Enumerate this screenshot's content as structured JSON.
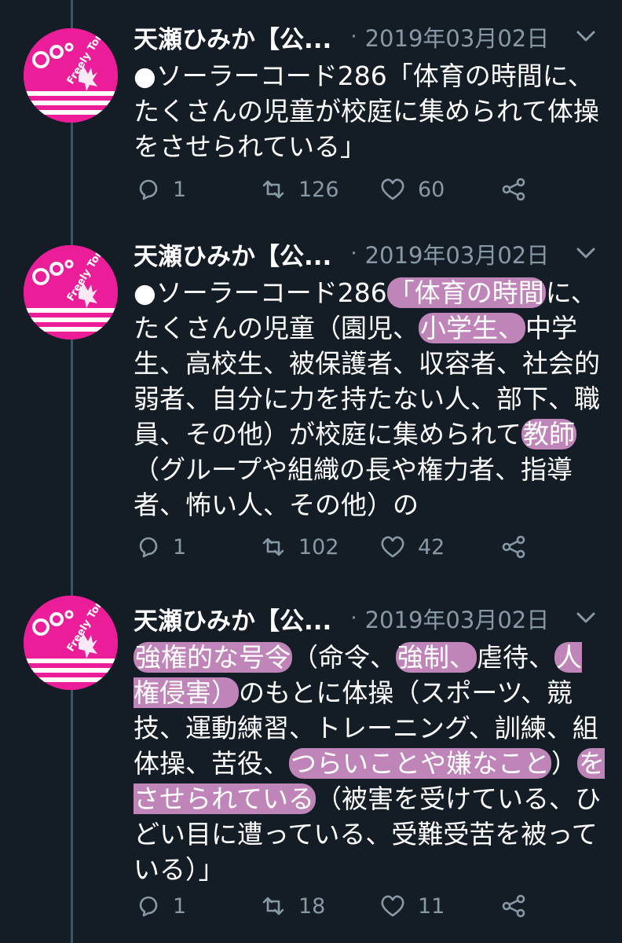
{
  "colors": {
    "background": "#141d26",
    "accent_pink": "#ec1d99",
    "highlight": "#bf85b8",
    "muted": "#8899a6"
  },
  "icons": {
    "reply": "reply-icon",
    "retweet": "retweet-icon",
    "like": "heart-icon",
    "share": "share-icon",
    "menu": "chevron-down-icon"
  },
  "avatar_text": "Freely Tomorrow",
  "tweets": [
    {
      "name": "天瀬ひみか【公...",
      "separator": "·",
      "date": "2019年03月02日",
      "text_segments": [
        {
          "t": "●ソーラーコード286「体育の時間に、たくさんの児童が校庭に集められて体操をさせられている」",
          "h": false
        }
      ],
      "replies": "1",
      "retweets": "126",
      "likes": "60"
    },
    {
      "name": "天瀬ひみか【公...",
      "separator": "·",
      "date": "2019年03月02日",
      "text_segments": [
        {
          "t": "●ソーラーコード286",
          "h": false
        },
        {
          "t": "「体育の時間",
          "h": true
        },
        {
          "t": "に、たくさんの児童（園児、",
          "h": false
        },
        {
          "t": "小学生、",
          "h": true
        },
        {
          "t": "中学生、高校生、被保護者、収容者、社会的弱者、自分に力を持たない人、部下、職員、その他）が校庭に集められて",
          "h": false
        },
        {
          "t": "教師",
          "h": true
        },
        {
          "t": "（グループや組織の長や権力者、指導者、怖い人、その他）の",
          "h": false
        }
      ],
      "replies": "1",
      "retweets": "102",
      "likes": "42"
    },
    {
      "name": "天瀬ひみか【公...",
      "separator": "·",
      "date": "2019年03月02日",
      "text_segments": [
        {
          "t": "強権的な号令",
          "h": true
        },
        {
          "t": "（命令、",
          "h": false
        },
        {
          "t": "強制、",
          "h": true
        },
        {
          "t": "虐待、",
          "h": false
        },
        {
          "t": "人権侵害）",
          "h": true
        },
        {
          "t": "のもとに体操（スポーツ、競技、運動練習、トレーニング、訓練、組体操、苦役、",
          "h": false
        },
        {
          "t": "つらいことや嫌なこと",
          "h": true
        },
        {
          "t": "）",
          "h": false
        },
        {
          "t": "をさせられている",
          "h": true
        },
        {
          "t": "（被害を受けている、ひどい目に遭っている、受難受苦を被っている）」",
          "h": false
        }
      ],
      "replies": "1",
      "retweets": "18",
      "likes": "11"
    }
  ]
}
